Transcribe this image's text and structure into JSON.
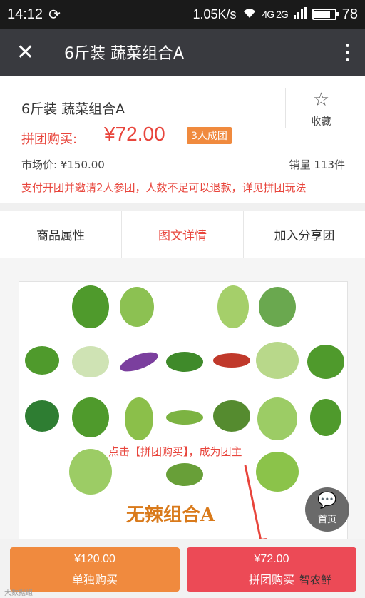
{
  "status_bar": {
    "time": "14:12",
    "speed": "1.05K/s",
    "network": "4G 2G",
    "battery": "78",
    "battery_level": 0.78
  },
  "header": {
    "title": "6斤装 蔬菜组合A"
  },
  "product": {
    "name": "6斤装 蔬菜组合A",
    "favorite_label": "收藏",
    "group_label": "拼团购买:",
    "group_price": "¥72.00",
    "group_badge": "3人成团",
    "market_price": "市场价: ¥150.00",
    "sales": "销量 113件",
    "notice": "支付开团并邀请2人参团，人数不足可以退款，详见拼团玩法"
  },
  "tabs": [
    {
      "label": "商品属性",
      "active": false
    },
    {
      "label": "图文详情",
      "active": true
    },
    {
      "label": "加入分享团",
      "active": false
    }
  ],
  "detail": {
    "poster_title": "无辣组合A",
    "annotation": "点击【拼团购买】，成为团主"
  },
  "float_home": {
    "label": "首页"
  },
  "bottom_bar": {
    "single_price": "¥120.00",
    "single_label": "单独购买",
    "group_price": "¥72.00",
    "group_label": "拼团购买"
  },
  "watermark": {
    "left": "大数据组",
    "right": "智农鲜"
  },
  "colors": {
    "accent": "#e8453c",
    "orange": "#f08a3e",
    "appbar": "#393a3f"
  }
}
